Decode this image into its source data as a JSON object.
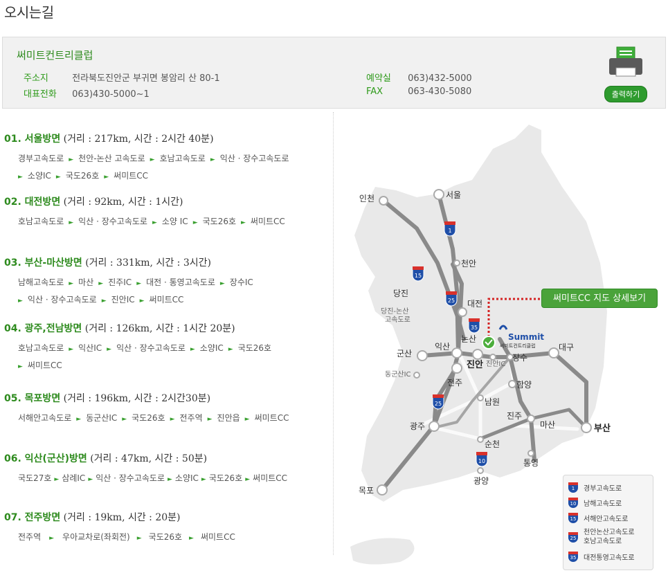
{
  "page_title": "오시는길",
  "club": {
    "name": "써미트컨트리클럽",
    "address_label": "주소지",
    "address": "전라북도진안군 부귀면 봉암리 산 80-1",
    "phone_label": "대표전화",
    "phone": "063)430-5000~1",
    "reserve_label": "예약실",
    "reserve": "063)432-5000",
    "fax_label": "FAX",
    "fax": "063-430-5080",
    "print_label": "출력하기"
  },
  "routes": [
    {
      "title": "01. 서울방면",
      "info": "(거리 : 217km, 시간 : 2시간 40분)",
      "steps": [
        "경부고속도로",
        "천안-논산 고속도로",
        "호남고속도로",
        "익산 · 장수고속도로",
        "소양IC",
        "국도26호",
        "써미트CC"
      ]
    },
    {
      "title": "02. 대전방면",
      "info": "(거리 : 92km, 시간 : 1시간)",
      "steps": [
        "호남고속도로",
        "익산 · 장수고속도로",
        "소양 IC",
        "국도26호",
        "써미트CC"
      ]
    },
    {
      "title": "03. 부산-마산방면",
      "info": "(거리 : 331km, 시간 : 3시간)",
      "steps": [
        "남해고속도로",
        "마산",
        "진주IC",
        "대전 · 통영고속도로",
        "장수IC",
        "익산 · 장수고속도로",
        "진안IC",
        "써미트CC"
      ]
    },
    {
      "title": "04. 광주,전남방면",
      "info": "(거리 : 126km, 시간 : 1시간 20분)",
      "steps": [
        "호남고속도로",
        "익산IC",
        "익산 · 장수고속도로",
        "소양IC",
        "국도26호",
        "써미트CC"
      ]
    },
    {
      "title": "05. 목포방면",
      "info": "(거리 : 196km, 시간 : 2시간30분)",
      "steps": [
        "서해안고속도로",
        "동군산IC",
        "국도26호",
        "전주역",
        "진안읍",
        "써미트CC"
      ]
    },
    {
      "title": "06. 익산(군산)방면",
      "info": "(거리 : 47km, 시간 : 50분)",
      "steps": [
        "국도27호",
        "삼례IC",
        "익산 · 장수고속도로",
        "소양IC",
        "국도26호",
        "써미트CC"
      ]
    },
    {
      "title": "07. 전주방면",
      "info": "(거리 : 19km, 시간 : 20분)",
      "steps": [
        "전주역",
        "우아교차로(좌회전)",
        "국도26호",
        "써미트CC"
      ]
    }
  ],
  "map": {
    "cities": {
      "seoul": "서울",
      "incheon": "인천",
      "cheonan": "천안",
      "dangjin": "당진",
      "dangjin_nonsan_1": "당진-논산",
      "dangjin_nonsan_2": "고속도로",
      "daejeon": "대전",
      "nonsan": "논산",
      "iksan": "익산",
      "gunsan": "군산",
      "jinan": "진안",
      "jinan_ic": "진안IC",
      "jangsu": "장수",
      "daegu": "대구",
      "donggunsan_ic": "동군산IC",
      "jeonju": "전주",
      "hamyang": "함양",
      "namwon": "남원",
      "jinju": "진주",
      "masan": "마산",
      "busan": "부산",
      "gwangju": "광주",
      "suncheon": "순천",
      "tongyeong": "통영",
      "gwangyang": "광양",
      "mokpo": "목포"
    },
    "shields": {
      "s1": "1",
      "s10": "10",
      "s15": "15",
      "s25": "25",
      "s35": "35"
    },
    "logo_text": "Summit",
    "logo_sub": "써미트컨트리클럽",
    "detail_button": "써미트CC 지도 상세보기"
  },
  "legend": [
    {
      "num": "1",
      "label": "경부고속도로"
    },
    {
      "num": "10",
      "label": "남해고속도로"
    },
    {
      "num": "15",
      "label": "서해안고속도로"
    },
    {
      "num": "25",
      "label": "천안논산고속도로",
      "label2": "호남고속도로"
    },
    {
      "num": "35",
      "label": "대전통영고속도로"
    }
  ],
  "colors": {
    "accent_green": "#2e8b1e",
    "shield_red": "#d9312b",
    "shield_blue": "#1f4fa8"
  }
}
